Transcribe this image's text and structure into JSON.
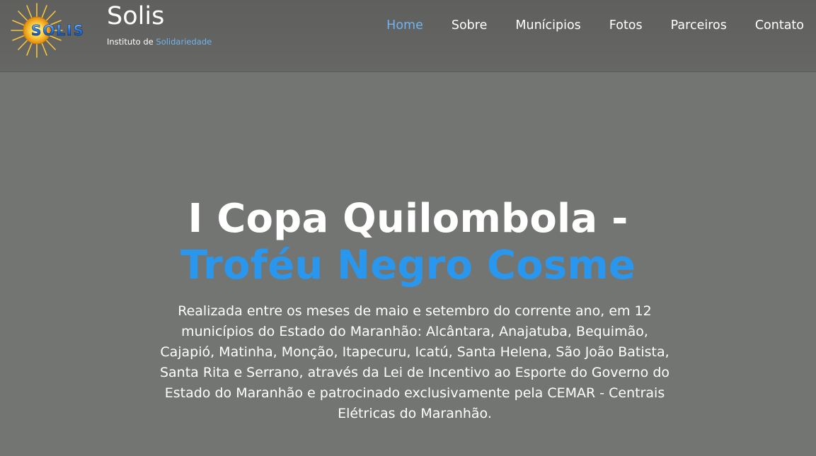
{
  "brand": {
    "name": "Solis",
    "subtitle_prefix": "Instituto de",
    "subtitle_accent": "Solidariedade",
    "logo_text": "SOLIS"
  },
  "nav": {
    "items": [
      {
        "label": "Home",
        "active": true
      },
      {
        "label": "Sobre",
        "active": false
      },
      {
        "label": "Munícipios",
        "active": false
      },
      {
        "label": "Fotos",
        "active": false
      },
      {
        "label": "Parceiros",
        "active": false
      },
      {
        "label": "Contato",
        "active": false
      }
    ]
  },
  "hero": {
    "title_line1": "I Copa Quilombola -",
    "title_line2": "Troféu Negro Cosme",
    "description": "Realizada entre os meses de maio e setembro do corrente ano, em 12 municípios do Estado do Maranhão: Alcântara, Anajatuba, Bequimão, Cajapió, Matinha, Monção, Itapecuru, Icatú, Santa Helena, São João Batista, Santa Rita e Serrano, através da Lei de Incentivo ao Esporte do Governo do Estado do Maranhão e patrocinado exclusivamente pela CEMAR - Centrais Elétricas do Maranhão."
  },
  "colors": {
    "accent": "#2a97ee",
    "nav_active": "#6fb4ee",
    "header_bg": "#636462",
    "hero_bg": "#737572",
    "logo_sun": "#f4b81c",
    "logo_text": "#1c5fb8"
  },
  "icons": {
    "logo": "sun-logo-icon"
  }
}
